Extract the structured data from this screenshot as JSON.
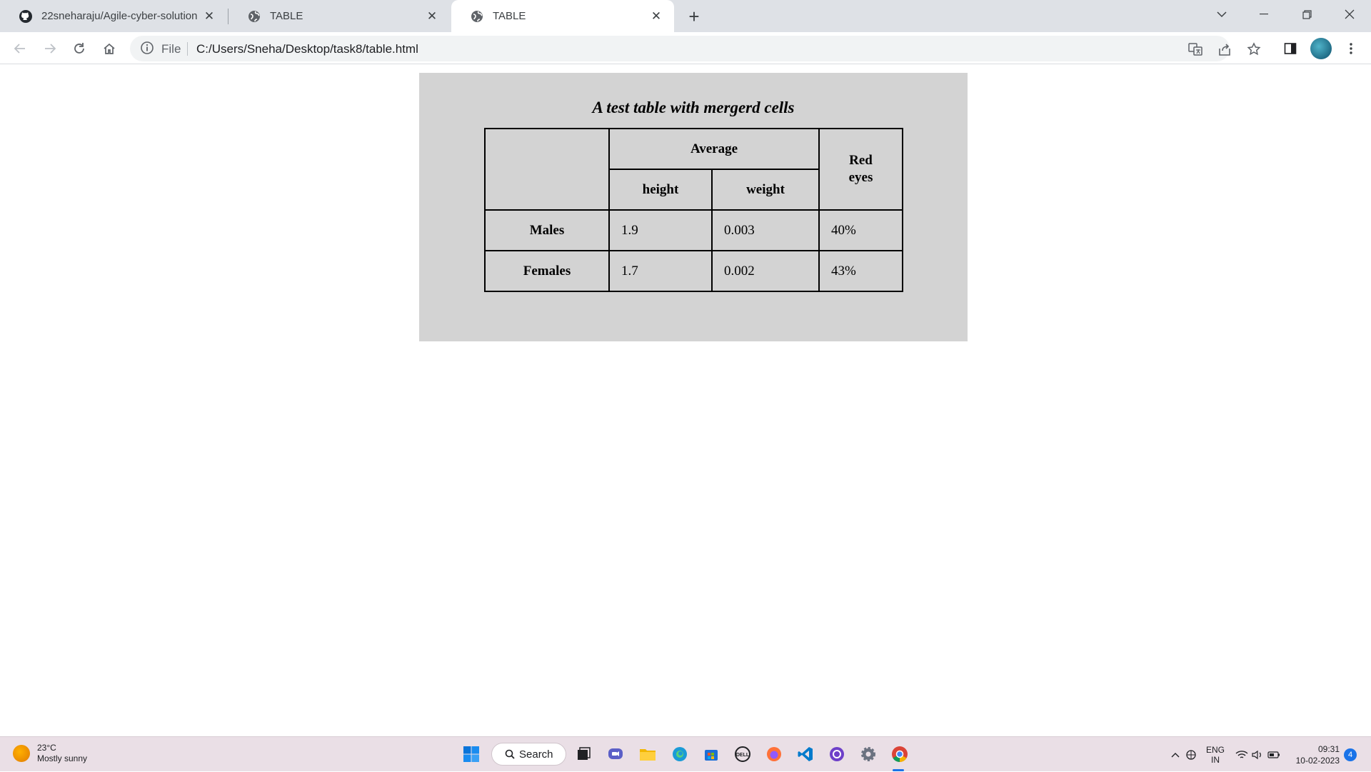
{
  "browser": {
    "tabs": [
      {
        "title": "22sneharaju/Agile-cyber-solution",
        "favicon": "github-icon"
      },
      {
        "title": "TABLE",
        "favicon": "globe-icon"
      },
      {
        "title": "TABLE",
        "favicon": "globe-icon",
        "active": true
      }
    ],
    "address_bar": {
      "scheme_label": "File",
      "url": "C:/Users/Sneha/Desktop/task8/table.html"
    }
  },
  "page": {
    "caption": "A test table with mergerd cells",
    "table": {
      "group_header": "Average",
      "sub_headers": [
        "height",
        "weight"
      ],
      "red_eyes_header": "Red eyes",
      "rows": [
        {
          "label": "Males",
          "height": "1.9",
          "weight": "0.003",
          "red_eyes": "40%"
        },
        {
          "label": "Females",
          "height": "1.7",
          "weight": "0.002",
          "red_eyes": "43%"
        }
      ]
    },
    "panel_color": "#d3d3d3"
  },
  "taskbar": {
    "weather_temp": "23°C",
    "weather_desc": "Mostly sunny",
    "search_label": "Search",
    "language_line1": "ENG",
    "language_line2": "IN",
    "time": "09:31",
    "date": "10-02-2023",
    "notification_count": "4"
  }
}
